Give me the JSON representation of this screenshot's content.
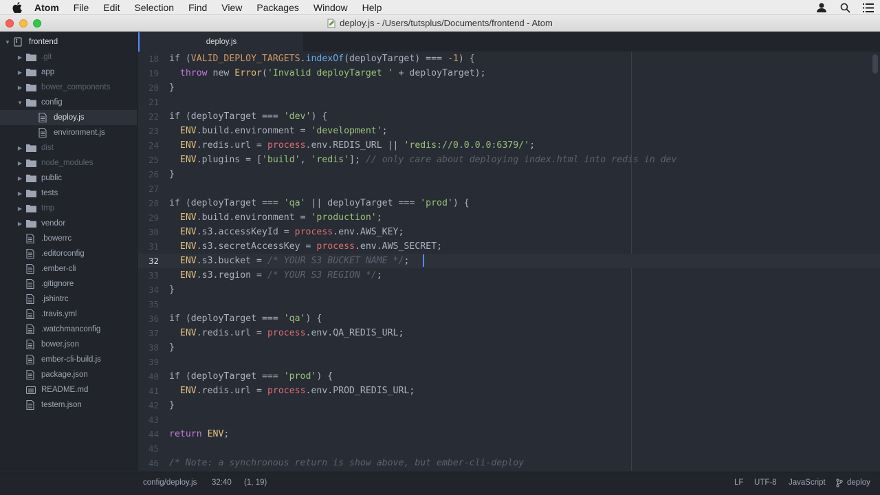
{
  "menubar": {
    "app": "Atom",
    "items": [
      "File",
      "Edit",
      "Selection",
      "Find",
      "View",
      "Packages",
      "Window",
      "Help"
    ]
  },
  "window": {
    "title": "deploy.js - /Users/tutsplus/Documents/frontend - Atom"
  },
  "tree": {
    "root": "frontend",
    "items": [
      {
        "label": ".git",
        "kind": "folder",
        "expanded": false,
        "dim": true,
        "depth": 1
      },
      {
        "label": "app",
        "kind": "folder",
        "expanded": false,
        "dim": false,
        "depth": 1
      },
      {
        "label": "bower_components",
        "kind": "folder",
        "expanded": false,
        "dim": true,
        "depth": 1
      },
      {
        "label": "config",
        "kind": "folder",
        "expanded": true,
        "dim": false,
        "depth": 1
      },
      {
        "label": "deploy.js",
        "kind": "file",
        "selected": true,
        "depth": 2
      },
      {
        "label": "environment.js",
        "kind": "file",
        "depth": 2
      },
      {
        "label": "dist",
        "kind": "folder",
        "expanded": false,
        "dim": true,
        "depth": 1
      },
      {
        "label": "node_modules",
        "kind": "folder",
        "expanded": false,
        "dim": true,
        "depth": 1
      },
      {
        "label": "public",
        "kind": "folder",
        "expanded": false,
        "dim": false,
        "depth": 1
      },
      {
        "label": "tests",
        "kind": "folder",
        "expanded": false,
        "dim": false,
        "depth": 1
      },
      {
        "label": "tmp",
        "kind": "folder",
        "expanded": false,
        "dim": true,
        "depth": 1
      },
      {
        "label": "vendor",
        "kind": "folder",
        "expanded": false,
        "dim": false,
        "depth": 1
      },
      {
        "label": ".bowerrc",
        "kind": "file",
        "depth": 1
      },
      {
        "label": ".editorconfig",
        "kind": "file",
        "depth": 1
      },
      {
        "label": ".ember-cli",
        "kind": "file",
        "depth": 1
      },
      {
        "label": ".gitignore",
        "kind": "file",
        "depth": 1
      },
      {
        "label": ".jshintrc",
        "kind": "file",
        "depth": 1
      },
      {
        "label": ".travis.yml",
        "kind": "file",
        "depth": 1
      },
      {
        "label": ".watchmanconfig",
        "kind": "file",
        "depth": 1
      },
      {
        "label": "bower.json",
        "kind": "file",
        "depth": 1
      },
      {
        "label": "ember-cli-build.js",
        "kind": "file",
        "depth": 1
      },
      {
        "label": "package.json",
        "kind": "file",
        "depth": 1
      },
      {
        "label": "README.md",
        "kind": "markdown",
        "depth": 1
      },
      {
        "label": "testem.json",
        "kind": "file",
        "depth": 1
      }
    ]
  },
  "tab": {
    "label": "deploy.js"
  },
  "editor": {
    "lines": [
      {
        "n": "18",
        "t": [
          [
            "",
            "if ("
          ],
          [
            "const",
            "VALID_DEPLOY_TARGETS"
          ],
          [
            "",
            "."
          ],
          [
            "fn",
            "indexOf"
          ],
          [
            "",
            "(deployTarget) === "
          ],
          [
            "num",
            "-1"
          ],
          [
            "",
            ") {"
          ]
        ]
      },
      {
        "n": "19",
        "t": [
          [
            "",
            "  "
          ],
          [
            "kw",
            "throw"
          ],
          [
            "",
            " new "
          ],
          [
            "cls",
            "Error"
          ],
          [
            "",
            "("
          ],
          [
            "str",
            "'Invalid deployTarget '"
          ],
          [
            "",
            " + deployTarget);"
          ]
        ]
      },
      {
        "n": "20",
        "t": [
          [
            "",
            "}"
          ]
        ]
      },
      {
        "n": "21",
        "t": [
          [
            "",
            ""
          ]
        ]
      },
      {
        "n": "22",
        "t": [
          [
            "",
            "if (deployTarget === "
          ],
          [
            "str",
            "'dev'"
          ],
          [
            "",
            ") {"
          ]
        ]
      },
      {
        "n": "23",
        "t": [
          [
            "",
            "  "
          ],
          [
            "env",
            "ENV"
          ],
          [
            "",
            ".build.environment = "
          ],
          [
            "str",
            "'development'"
          ],
          [
            "",
            ";"
          ]
        ]
      },
      {
        "n": "24",
        "t": [
          [
            "",
            "  "
          ],
          [
            "env",
            "ENV"
          ],
          [
            "",
            ".redis.url = "
          ],
          [
            "proc",
            "process"
          ],
          [
            "",
            ".env.REDIS_URL || "
          ],
          [
            "str",
            "'redis://0.0.0.0:6379/'"
          ],
          [
            "",
            ";"
          ]
        ]
      },
      {
        "n": "25",
        "t": [
          [
            "",
            "  "
          ],
          [
            "env",
            "ENV"
          ],
          [
            "",
            ".plugins = ["
          ],
          [
            "str",
            "'build'"
          ],
          [
            "",
            ", "
          ],
          [
            "str",
            "'redis'"
          ],
          [
            "",
            "]; "
          ],
          [
            "cmt",
            "// only care about deploying index.html into redis in dev"
          ]
        ]
      },
      {
        "n": "26",
        "t": [
          [
            "",
            "}"
          ]
        ]
      },
      {
        "n": "27",
        "t": [
          [
            "",
            ""
          ]
        ]
      },
      {
        "n": "28",
        "t": [
          [
            "",
            "if (deployTarget === "
          ],
          [
            "str",
            "'qa'"
          ],
          [
            "",
            " || deployTarget === "
          ],
          [
            "str",
            "'prod'"
          ],
          [
            "",
            ") {"
          ]
        ]
      },
      {
        "n": "29",
        "t": [
          [
            "",
            "  "
          ],
          [
            "env",
            "ENV"
          ],
          [
            "",
            ".build.environment = "
          ],
          [
            "str",
            "'production'"
          ],
          [
            "",
            ";"
          ]
        ]
      },
      {
        "n": "30",
        "t": [
          [
            "",
            "  "
          ],
          [
            "env",
            "ENV"
          ],
          [
            "",
            ".s3.accessKeyId = "
          ],
          [
            "proc",
            "process"
          ],
          [
            "",
            ".env.AWS_KEY;"
          ]
        ]
      },
      {
        "n": "31",
        "t": [
          [
            "",
            "  "
          ],
          [
            "env",
            "ENV"
          ],
          [
            "",
            ".s3.secretAccessKey = "
          ],
          [
            "proc",
            "process"
          ],
          [
            "",
            ".env.AWS_SECRET;"
          ]
        ]
      },
      {
        "n": "32",
        "t": [
          [
            "",
            "  "
          ],
          [
            "env",
            "ENV"
          ],
          [
            "",
            ".s3.bucket = "
          ],
          [
            "cmt",
            "/* YOUR S3 BUCKET NAME */"
          ],
          [
            "",
            ";"
          ]
        ]
      },
      {
        "n": "33",
        "t": [
          [
            "",
            "  "
          ],
          [
            "env",
            "ENV"
          ],
          [
            "",
            ".s3.region = "
          ],
          [
            "cmt",
            "/* YOUR S3 REGION */"
          ],
          [
            "",
            ";"
          ]
        ]
      },
      {
        "n": "34",
        "t": [
          [
            "",
            "}"
          ]
        ]
      },
      {
        "n": "35",
        "t": [
          [
            "",
            ""
          ]
        ]
      },
      {
        "n": "36",
        "t": [
          [
            "",
            "if (deployTarget === "
          ],
          [
            "str",
            "'qa'"
          ],
          [
            "",
            ") {"
          ]
        ]
      },
      {
        "n": "37",
        "t": [
          [
            "",
            "  "
          ],
          [
            "env",
            "ENV"
          ],
          [
            "",
            ".redis.url = "
          ],
          [
            "proc",
            "process"
          ],
          [
            "",
            ".env.QA_REDIS_URL;"
          ]
        ]
      },
      {
        "n": "38",
        "t": [
          [
            "",
            "}"
          ]
        ]
      },
      {
        "n": "39",
        "t": [
          [
            "",
            ""
          ]
        ]
      },
      {
        "n": "40",
        "t": [
          [
            "",
            "if (deployTarget === "
          ],
          [
            "str",
            "'prod'"
          ],
          [
            "",
            ") {"
          ]
        ]
      },
      {
        "n": "41",
        "t": [
          [
            "",
            "  "
          ],
          [
            "env",
            "ENV"
          ],
          [
            "",
            ".redis.url = "
          ],
          [
            "proc",
            "process"
          ],
          [
            "",
            ".env.PROD_REDIS_URL;"
          ]
        ]
      },
      {
        "n": "42",
        "t": [
          [
            "",
            "}"
          ]
        ]
      },
      {
        "n": "43",
        "t": [
          [
            "",
            ""
          ]
        ]
      },
      {
        "n": "44",
        "t": [
          [
            "kw",
            "return"
          ],
          [
            "",
            " "
          ],
          [
            "env",
            "ENV"
          ],
          [
            "",
            ";"
          ]
        ]
      },
      {
        "n": "45",
        "t": [
          [
            "",
            ""
          ]
        ]
      },
      {
        "n": "46",
        "t": [
          [
            "cmt",
            "/* Note: a synchronous return is show above, but ember-cli-deploy"
          ]
        ]
      }
    ],
    "cursor_line": "32"
  },
  "statusbar": {
    "path": "config/deploy.js",
    "position": "32:40",
    "selection": "(1, 19)",
    "line_ending": "LF",
    "encoding": "UTF-8",
    "grammar": "JavaScript",
    "branch": "deploy"
  },
  "colors": {
    "accent": "#528bff",
    "bg": "#282c34",
    "panel": "#21252b"
  }
}
